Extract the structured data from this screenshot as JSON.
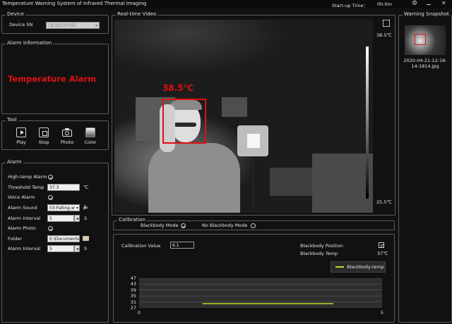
{
  "window": {
    "title": "Temperature Warning System of Infrared Thermal Imaging",
    "startup_label": "Start-up Time：",
    "startup_value": "0h:0m"
  },
  "device": {
    "group_title": "Device",
    "sn_label": "Device SN",
    "sn_value": "LB1822SY/B2"
  },
  "alarm_info": {
    "group_title": "Alarm information",
    "message": "Temperature Alarm",
    "message_color": "#e01010"
  },
  "tool": {
    "group_title": "Tool",
    "buttons": [
      {
        "label": "Play",
        "icon": "play-icon"
      },
      {
        "label": "Stop",
        "icon": "stop-icon"
      },
      {
        "label": "Photo",
        "icon": "camera-icon"
      },
      {
        "label": "Color",
        "icon": "color-gradient-icon"
      }
    ]
  },
  "alarm": {
    "group_title": "Alarm",
    "high_temp_label": "High-temp Alarm",
    "threshold_label": "Threshold Temp",
    "threshold_value": "37.3",
    "threshold_unit": "℃",
    "voice_label": "Voice Alarm",
    "sound_label": "Alarm Sound",
    "sound_value": "03-Falling.w",
    "interval_label": "Alarm Interval",
    "interval_value": "5",
    "interval_unit": "S",
    "photo_label": "Alarm Photo",
    "folder_label": "Folder",
    "folder_value": "E:\\Documents",
    "photo_interval_label": "Alarm Interval",
    "photo_interval_value": "5",
    "photo_interval_unit": "S"
  },
  "video": {
    "group_title": "Real-time Video",
    "scale_max": "38.5℃",
    "scale_min": "25.5℃",
    "detection_temp": "38.5℃",
    "detection_color": "#e01010"
  },
  "calibration": {
    "group_title": "Calibration",
    "blackbody_mode": "Blackbody Mode",
    "no_blackbody_mode": "No Blackbody Mode",
    "value_label": "Calibration Value",
    "value": "6.1",
    "position_label": "Blackbody Position",
    "temp_label": "Blackbody Temp",
    "temp_value": "37℃"
  },
  "chart_data": {
    "type": "line",
    "series": [
      {
        "name": "Blackbody-temp",
        "color": "#c8d820",
        "x": [
          1.3,
          4.0
        ],
        "y": [
          29.8,
          29.8
        ]
      }
    ],
    "xlim": [
      0,
      5
    ],
    "ylim": [
      27,
      47
    ],
    "yticks": [
      47,
      43,
      39,
      35,
      31,
      27
    ],
    "xticks": [
      0,
      5
    ],
    "grid": true,
    "legend_position": "top-right"
  },
  "snapshot": {
    "group_title": "Warning Snapshot",
    "caption": "2020-04-21-12-18-14-1814.jpg"
  }
}
